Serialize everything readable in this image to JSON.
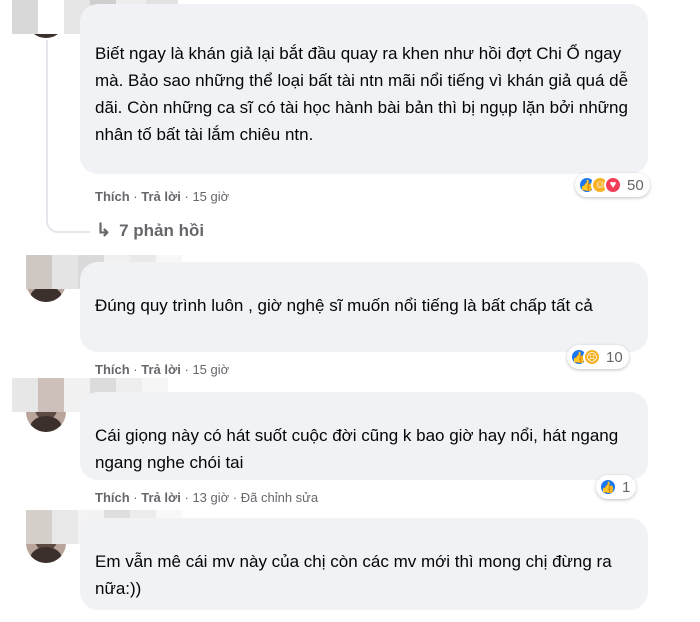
{
  "comments": [
    {
      "text": "Biết ngay là khán giả lại bắt đầu quay ra khen như hồi đợt Chi Ổ ngay mà. Bảo sao những thể loại bất tài ntn mãi nổi tiếng vì khán giả quá dễ dãi. Còn những ca sĩ có tài học hành bài bản thì bị ngụp lặn bởi những nhân tố bất tài lắm chiêu ntn.",
      "like": "Thích",
      "reply": "Trả lời",
      "time": "15 giờ",
      "reaction_icons": [
        "like-icon",
        "haha-icon",
        "love-icon"
      ],
      "reaction_count": "50"
    },
    {
      "text": "Đúng quy trình luôn , giờ nghệ sĩ muốn nổi tiếng là bất chấp tất cả",
      "like": "Thích",
      "reply": "Trả lời",
      "time": "15 giờ",
      "reaction_icons": [
        "like-icon",
        "sad-icon"
      ],
      "reaction_count": "10"
    },
    {
      "text": "Cái giọng này có hát suốt cuộc đời cũng k bao giờ hay nổi, hát ngang ngang nghe chói tai",
      "like": "Thích",
      "reply": "Trả lời",
      "time": "13 giờ",
      "edited": "Đã chỉnh sửa",
      "reaction_icons": [
        "like-icon"
      ],
      "reaction_count": "1"
    },
    {
      "text": "Em vẫn mê cái mv này của chị còn các mv mới thì mong chị đừng ra nữa:))"
    }
  ],
  "view_replies": "7 phản hồi",
  "separator": "·",
  "colors": {
    "bubble": "#f0f2f5",
    "meta": "#65676b",
    "like_blue": "#1877f2",
    "love_red": "#f33e58",
    "emoji_yellow": "#f7b125"
  }
}
